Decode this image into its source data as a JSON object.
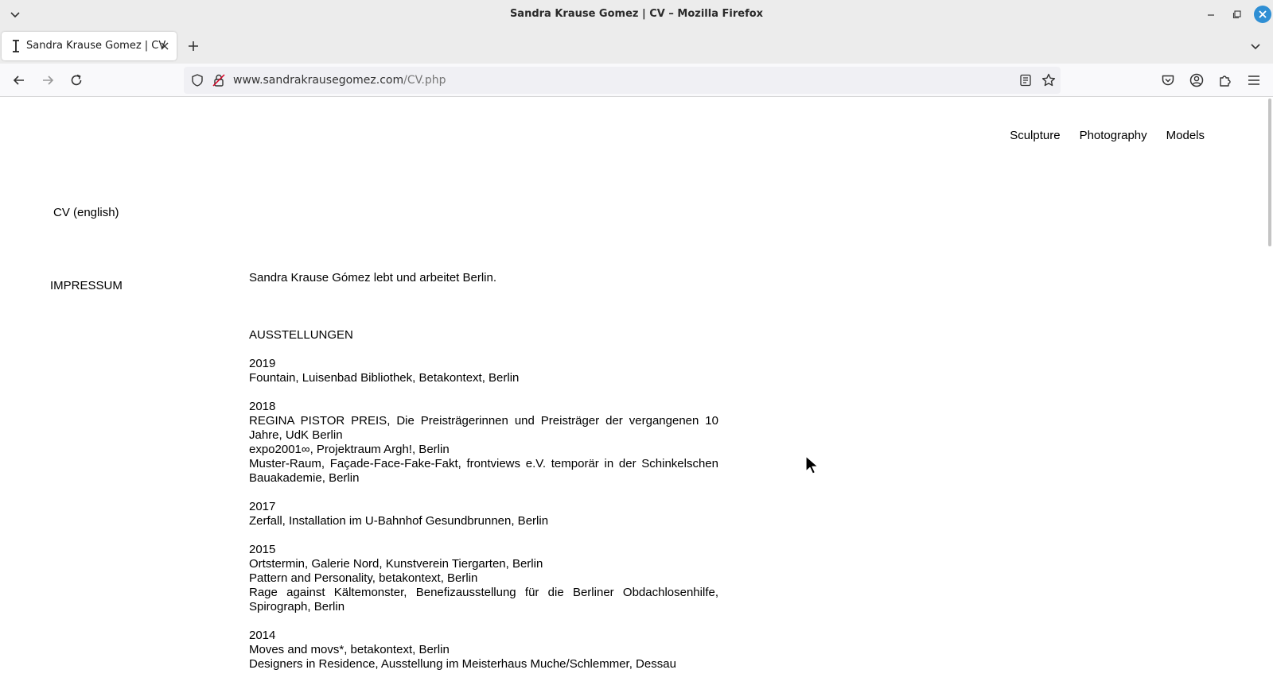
{
  "window": {
    "title": "Sandra Krause Gomez | CV – Mozilla Firefox"
  },
  "tabs": [
    {
      "label": "Sandra Krause Gomez | CV"
    }
  ],
  "urlbar": {
    "domain": "www.sandrakrausegomez.com",
    "path": "/CV.php"
  },
  "site": {
    "nav": [
      "Sculpture",
      "Photography",
      "Models"
    ],
    "side": {
      "cv_link": "CV (english)",
      "impressum": "IMPRESSUM"
    },
    "intro": "Sandra Krause Gómez lebt und arbeitet Berlin.",
    "section_title": "AUSSTELLUNGEN",
    "years": [
      {
        "year": "2019",
        "entries": [
          "Fountain, Luisenbad Bibliothek, Betakontext, Berlin"
        ]
      },
      {
        "year": "2018",
        "entries": [
          "REGINA PISTOR PREIS, Die Preisträgerinnen und Preisträger der vergangenen 10 Jahre, UdK Berlin",
          "expo2001∞, Projektraum Argh!, Berlin",
          "Muster-Raum, Façade-Face-Fake-Fakt, frontviews e.V. temporär in der Schinkelschen Bauakademie, Berlin"
        ]
      },
      {
        "year": "2017",
        "entries": [
          "Zerfall, Installation im U-Bahnhof Gesundbrunnen, Berlin"
        ]
      },
      {
        "year": "2015",
        "entries": [
          "Ortstermin, Galerie Nord, Kunstverein Tiergarten, Berlin",
          "Pattern and Personality, betakontext, Berlin",
          "Rage against Kältemonster, Benefizausstellung für die Berliner Obdachlosenhilfe, Spirograph, Berlin"
        ]
      },
      {
        "year": "2014",
        "entries": [
          "Moves and movs*, betakontext, Berlin",
          "Designers in Residence, Ausstellung im Meisterhaus Muche/Schlemmer, Dessau"
        ]
      }
    ]
  }
}
